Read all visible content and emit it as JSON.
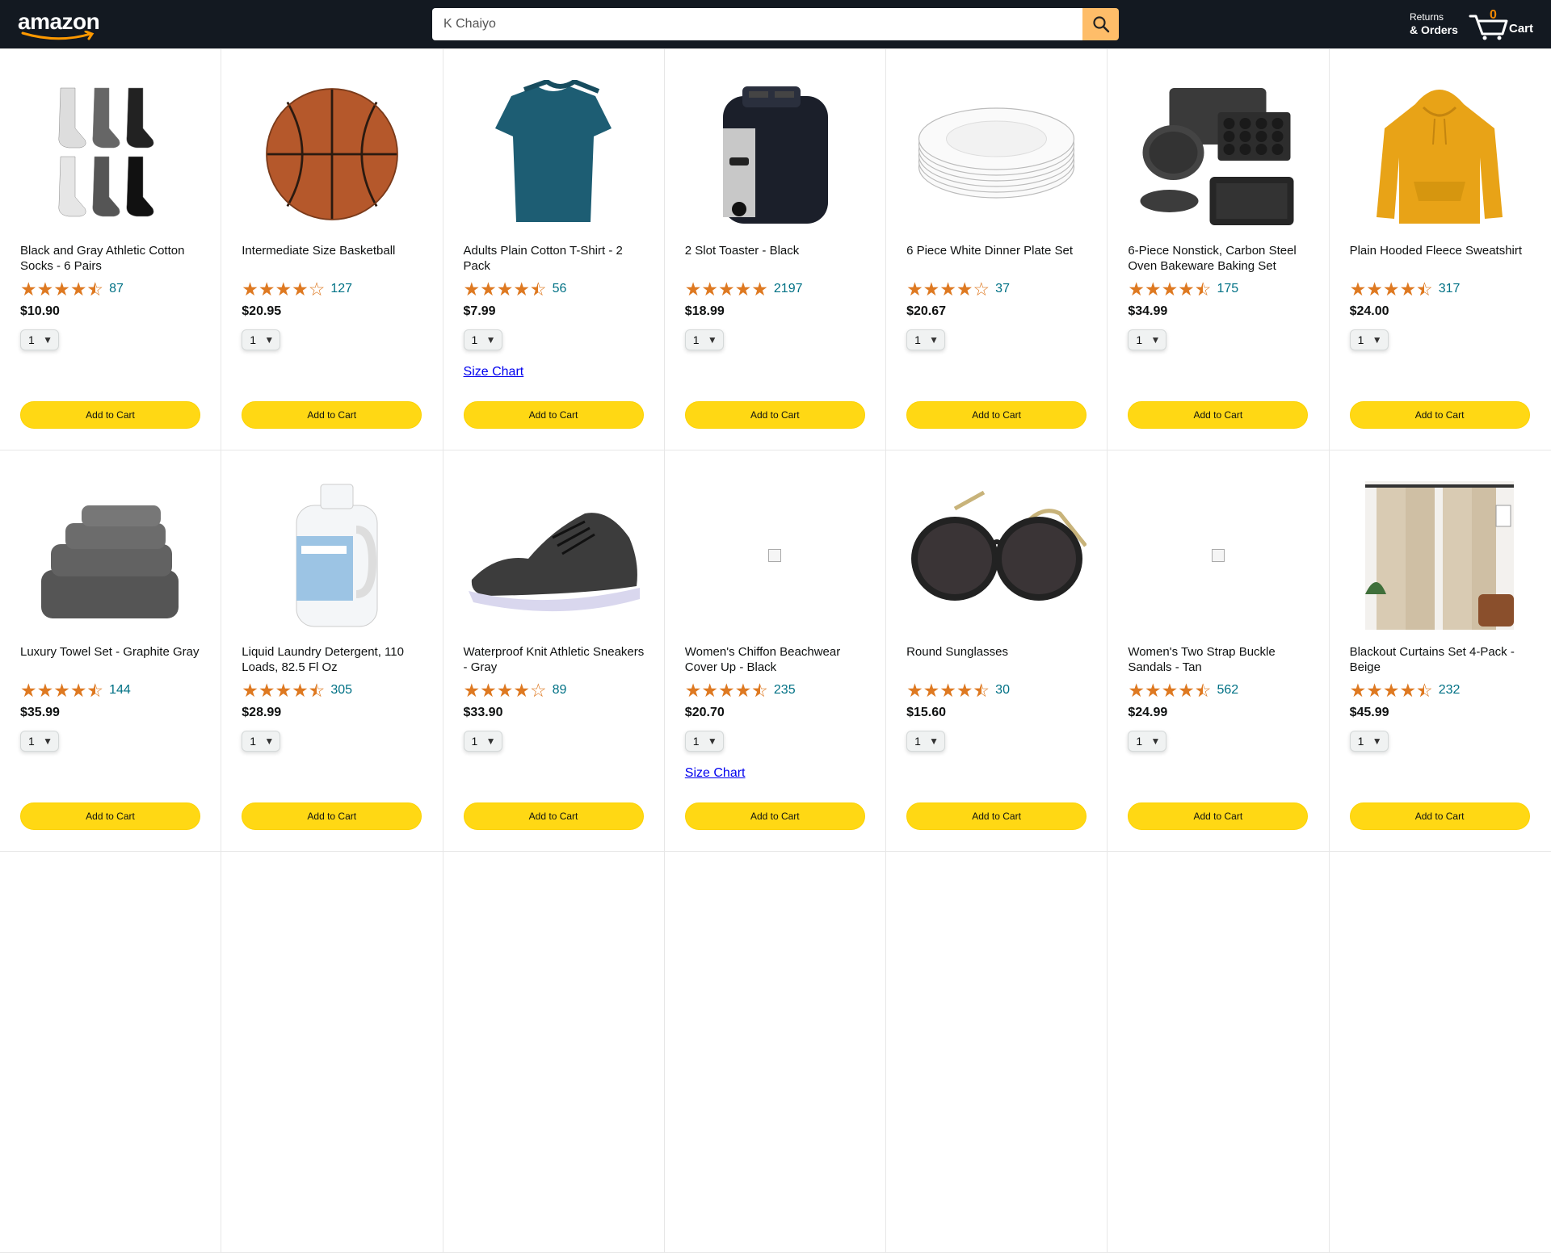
{
  "header": {
    "logo": "amazon",
    "search_value": "K Chaiyo",
    "returns_line1": "Returns",
    "returns_line2": "& Orders",
    "cart_count": "0",
    "cart_label": "Cart"
  },
  "buttons": {
    "add_to_cart": "Add to Cart",
    "size_chart": "Size Chart"
  },
  "colors": {
    "header": "#131921",
    "search_button": "#febd69",
    "add_button": "#ffd814",
    "star": "#de7921",
    "link": "#007185",
    "cart_count": "#f08804"
  },
  "products": [
    {
      "title": "Black and Gray Athletic Cotton Socks - 6 Pairs",
      "rating": 4.5,
      "reviews": "87",
      "price": "$10.90",
      "qty": "1",
      "size_chart": false,
      "image": "socks"
    },
    {
      "title": "Intermediate Size Basketball",
      "rating": 4.0,
      "reviews": "127",
      "price": "$20.95",
      "qty": "1",
      "size_chart": false,
      "image": "basketball"
    },
    {
      "title": "Adults Plain Cotton T-Shirt - 2 Pack",
      "rating": 4.5,
      "reviews": "56",
      "price": "$7.99",
      "qty": "1",
      "size_chart": true,
      "image": "tshirt"
    },
    {
      "title": "2 Slot Toaster - Black",
      "rating": 5.0,
      "reviews": "2197",
      "price": "$18.99",
      "qty": "1",
      "size_chart": false,
      "image": "toaster"
    },
    {
      "title": "6 Piece White Dinner Plate Set",
      "rating": 4.0,
      "reviews": "37",
      "price": "$20.67",
      "qty": "1",
      "size_chart": false,
      "image": "plates"
    },
    {
      "title": "6-Piece Nonstick, Carbon Steel Oven Bakeware Baking Set",
      "rating": 4.5,
      "reviews": "175",
      "price": "$34.99",
      "qty": "1",
      "size_chart": false,
      "image": "bakeware"
    },
    {
      "title": "Plain Hooded Fleece Sweatshirt",
      "rating": 4.5,
      "reviews": "317",
      "price": "$24.00",
      "qty": "1",
      "size_chart": false,
      "image": "hoodie"
    },
    {
      "title": "Luxury Towel Set - Graphite Gray",
      "rating": 4.5,
      "reviews": "144",
      "price": "$35.99",
      "qty": "1",
      "size_chart": false,
      "image": "towels"
    },
    {
      "title": "Liquid Laundry Detergent, 110 Loads, 82.5 Fl Oz",
      "rating": 4.5,
      "reviews": "305",
      "price": "$28.99",
      "qty": "1",
      "size_chart": false,
      "image": "detergent"
    },
    {
      "title": "Waterproof Knit Athletic Sneakers - Gray",
      "rating": 4.0,
      "reviews": "89",
      "price": "$33.90",
      "qty": "1",
      "size_chart": false,
      "image": "sneaker"
    },
    {
      "title": "Women's Chiffon Beachwear Cover Up - Black",
      "rating": 4.5,
      "reviews": "235",
      "price": "$20.70",
      "qty": "1",
      "size_chart": true,
      "image": "broken"
    },
    {
      "title": "Round Sunglasses",
      "rating": 4.5,
      "reviews": "30",
      "price": "$15.60",
      "qty": "1",
      "size_chart": false,
      "image": "sunglasses"
    },
    {
      "title": "Women's Two Strap Buckle Sandals - Tan",
      "rating": 4.5,
      "reviews": "562",
      "price": "$24.99",
      "qty": "1",
      "size_chart": false,
      "image": "broken"
    },
    {
      "title": "Blackout Curtains Set 4-Pack - Beige",
      "rating": 4.5,
      "reviews": "232",
      "price": "$45.99",
      "qty": "1",
      "size_chart": false,
      "image": "curtains"
    }
  ]
}
